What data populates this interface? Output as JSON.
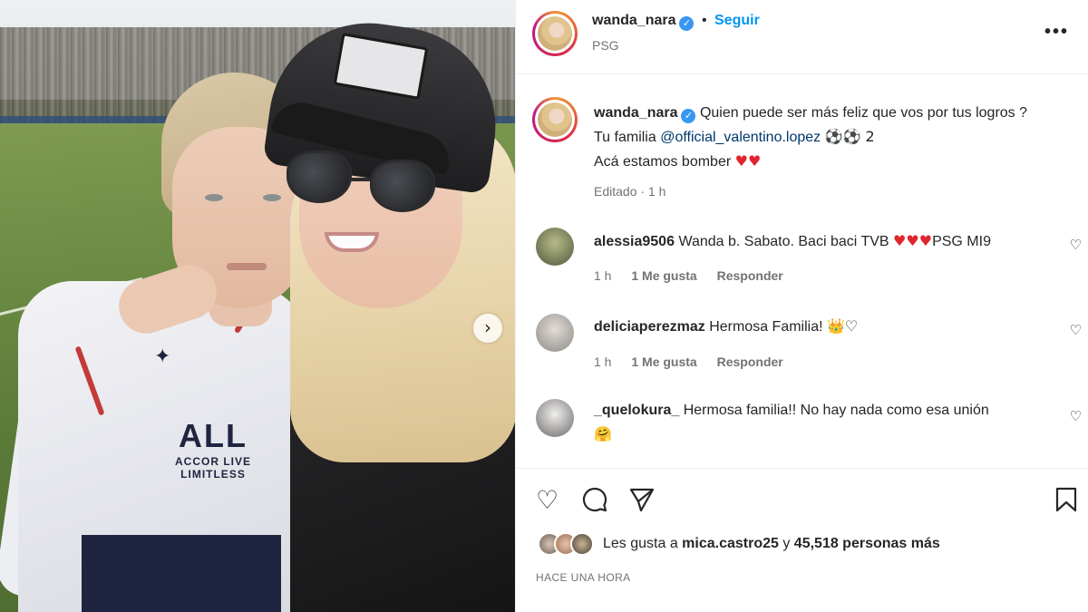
{
  "post": {
    "username": "wanda_nara",
    "follow_label": "Seguir",
    "location": "PSG",
    "more_icon": "more-horizontal-icon"
  },
  "caption": {
    "username": "wanda_nara",
    "text_1": "Quien puede ser más feliz que vos por tus logros ?",
    "text_2a": "Tu familia",
    "mention": "@official_valentino.lopez",
    "text_2b": "⚽⚽ 2",
    "text_3": "Acá estamos bomber",
    "hearts": "♥♥",
    "meta": "Editado · 1 h"
  },
  "comments": [
    {
      "username": "alessia9506",
      "text": "Wanda b. Sabato. Baci baci TVB",
      "hearts": "♥♥♥",
      "tail": "PSG MI9",
      "time": "1 h",
      "likes": "1 Me gusta",
      "reply": "Responder"
    },
    {
      "username": "deliciaperezmaz",
      "text": "Hermosa Familia!",
      "emoji": "👑♡",
      "time": "1 h",
      "likes": "1 Me gusta",
      "reply": "Responder"
    },
    {
      "username": "_quelokura_",
      "text": "Hermosa familia!! No hay nada como esa unión",
      "emoji": "🤗"
    }
  ],
  "likes": {
    "prefix": "Les gusta a ",
    "user": "mica.castro25",
    "middle": " y ",
    "count": "45,518 personas más"
  },
  "timestamp": "HACE UNA HORA",
  "colors": {
    "accent": "#0095f6",
    "heart": "#e0262d",
    "mention": "#00376b",
    "secondary": "#737373"
  }
}
